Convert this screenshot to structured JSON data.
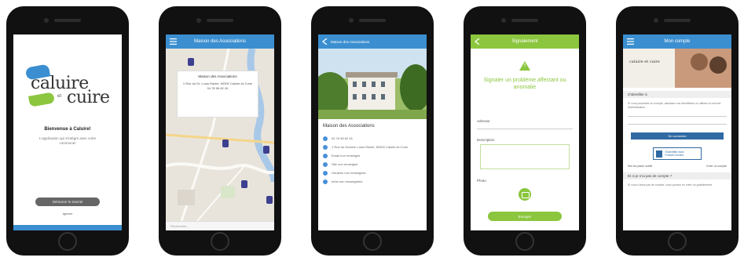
{
  "colors": {
    "accent_blue": "#3b8fd0",
    "accent_green": "#8cc63f",
    "navy": "#2f6aa3",
    "phone": "#111111"
  },
  "screen1": {
    "logo_top": "caluire",
    "logo_et": "et",
    "logo_bottom": "cuire",
    "welcome": "Bienvenue à Caluire!",
    "tagline": "L'application qui s'intègre avec votre commune!",
    "tutorial_button": "Démarrer le tutoriel",
    "skip_link": "Ignorer"
  },
  "screen2": {
    "title": "Maison des Associations",
    "popup_title": "Maison des Associations",
    "popup_lines": [
      "1 Rue du Dr. Louis Ravier, 69300 Caluire-et-Cuire",
      "04 78 98 82 26"
    ],
    "search_placeholder": "Rechercher..."
  },
  "screen3": {
    "nav_title": "Maison des Associations",
    "place_title": "Maison des Associations",
    "info": [
      {
        "icon": "phone-icon",
        "text": "04 78 98 82 26"
      },
      {
        "icon": "location-icon",
        "text": "1 Rue du Docteur Louis Ravier, 69300 Caluire-et-Cuire"
      },
      {
        "icon": "mail-icon",
        "text": "Email non renseigné"
      },
      {
        "icon": "web-icon",
        "text": "Site non renseigné"
      },
      {
        "icon": "clock-icon",
        "text": "Horaires non renseignés"
      },
      {
        "icon": "info-icon",
        "text": "Infos non renseignées"
      }
    ]
  },
  "screen4": {
    "nav_title": "Signalement",
    "title": "Signaler un problème affectant ou anomalie",
    "field_address": "Adresse",
    "field_description": "Description",
    "field_photo": "Photo",
    "send_button": "Envoyer"
  },
  "screen5": {
    "nav_title": "Mon compte",
    "banner_logo": "caluire et cuire",
    "section1": "S'identifier à",
    "intro": "Si vous possédez un compte, saisissez vos identifiants ou utilisez un service d'identification.",
    "login_button": "Se connecter",
    "fc_button": "S'identifier avec FranceConnect",
    "link_left": "Mot de passe oublié",
    "link_right": "Créer un compte",
    "section2": "Et si je n'ai pas de compte ?",
    "bottom_text": "Si vous n'avez pas de compte, vous pouvez en créer un gratuitement."
  }
}
